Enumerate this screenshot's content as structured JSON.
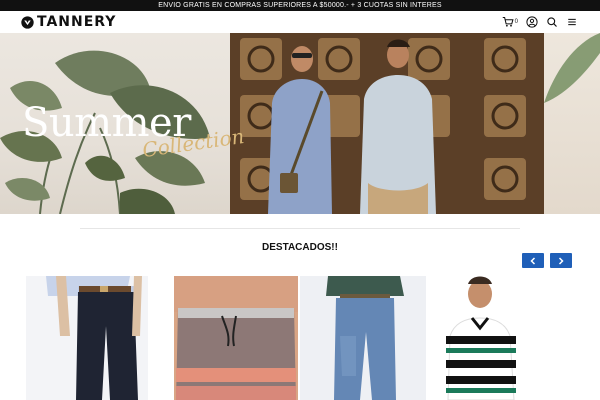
{
  "promo": {
    "text": "ENVIO GRATIS EN COMPRAS SUPERIORES A $50000.- + 3 CUOTAS SIN INTERES"
  },
  "header": {
    "brand": "TANNERY",
    "cart_count": "0",
    "icons": [
      "cart-icon",
      "user-icon",
      "search-icon",
      "menu-icon"
    ]
  },
  "hero": {
    "title": "Summer",
    "subtitle": "Collection"
  },
  "featured": {
    "title": "DESTACADOS!!",
    "prev_icon": "chevron-left-icon",
    "next_icon": "chevron-right-icon",
    "accent": "#1f5fb8"
  },
  "products": [
    {
      "name": "product-chino-pants"
    },
    {
      "name": "product-swim-shorts"
    },
    {
      "name": "product-jeans"
    },
    {
      "name": "product-striped-polo"
    }
  ]
}
